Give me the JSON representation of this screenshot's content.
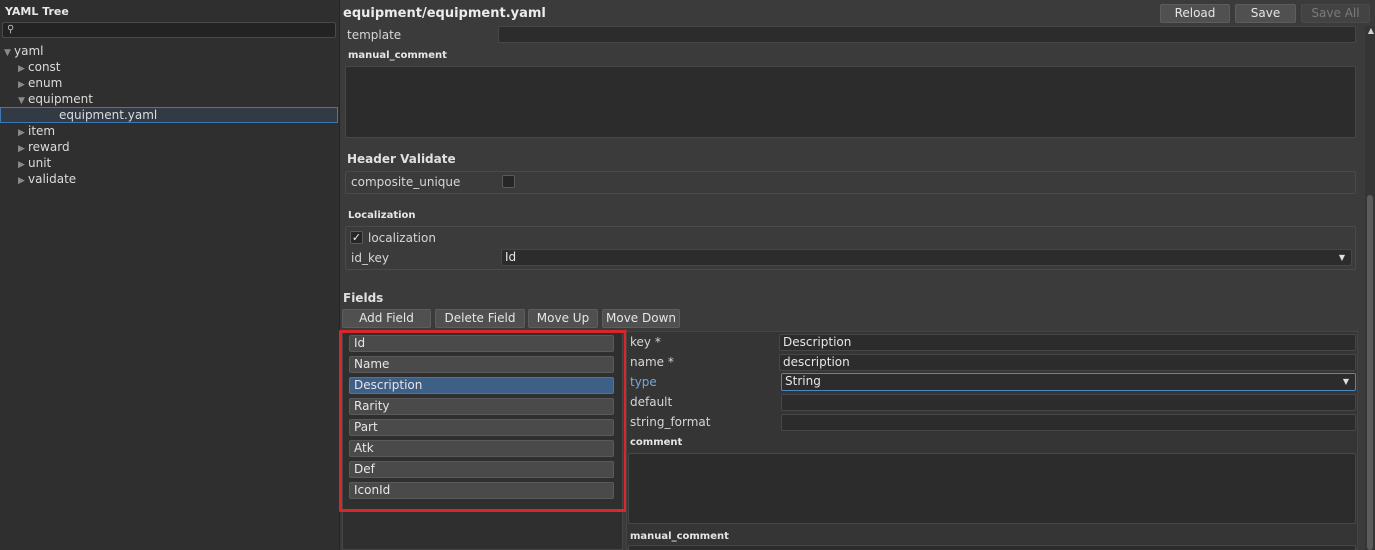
{
  "tree": {
    "title": "YAML Tree",
    "search_placeholder": "",
    "items": [
      {
        "label": "yaml",
        "arrow": "▼",
        "indent": 0
      },
      {
        "label": "const",
        "arrow": "▶",
        "indent": 1
      },
      {
        "label": "enum",
        "arrow": "▶",
        "indent": 1
      },
      {
        "label": "equipment",
        "arrow": "▼",
        "indent": 1
      },
      {
        "label": "equipment.yaml",
        "arrow": "",
        "indent": 2,
        "selected": true
      },
      {
        "label": "item",
        "arrow": "▶",
        "indent": 1
      },
      {
        "label": "reward",
        "arrow": "▶",
        "indent": 1
      },
      {
        "label": "unit",
        "arrow": "▶",
        "indent": 1
      },
      {
        "label": "validate",
        "arrow": "▶",
        "indent": 1
      }
    ]
  },
  "header": {
    "file_path": "equipment/equipment.yaml",
    "reload": "Reload",
    "save": "Save",
    "save_all": "Save All"
  },
  "template": {
    "label": "template",
    "value": ""
  },
  "manual_comment": {
    "label": "manual_comment",
    "value": ""
  },
  "header_validate": {
    "title": "Header Validate",
    "composite_unique_label": "composite_unique",
    "composite_unique_checked": false
  },
  "localization": {
    "title": "Localization",
    "checkbox_label": "localization",
    "checked": true,
    "check_mark": "✓",
    "id_key_label": "id_key",
    "id_key_value": "Id"
  },
  "fields": {
    "title": "Fields",
    "buttons": {
      "add": "Add Field",
      "delete": "Delete Field",
      "up": "Move Up",
      "down": "Move Down"
    },
    "items": [
      "Id",
      "Name",
      "Description",
      "Rarity",
      "Part",
      "Atk",
      "Def",
      "IconId"
    ],
    "selected_index": 2
  },
  "detail": {
    "key_label": "key *",
    "key_value": "Description",
    "name_label": "name *",
    "name_value": "description",
    "type_label": "type",
    "type_value": "String",
    "default_label": "default",
    "default_value": "",
    "string_format_label": "string_format",
    "string_format_value": "",
    "comment_label": "comment",
    "manual_comment_label": "manual_comment"
  },
  "colors": {
    "accent": "#78a6d8",
    "selection": "#3e5f86",
    "highlight": "#d9262b"
  },
  "icons": {
    "search": "search-icon",
    "dropdown": "chevron-down-icon",
    "scroll": "scroll-up-icon"
  }
}
